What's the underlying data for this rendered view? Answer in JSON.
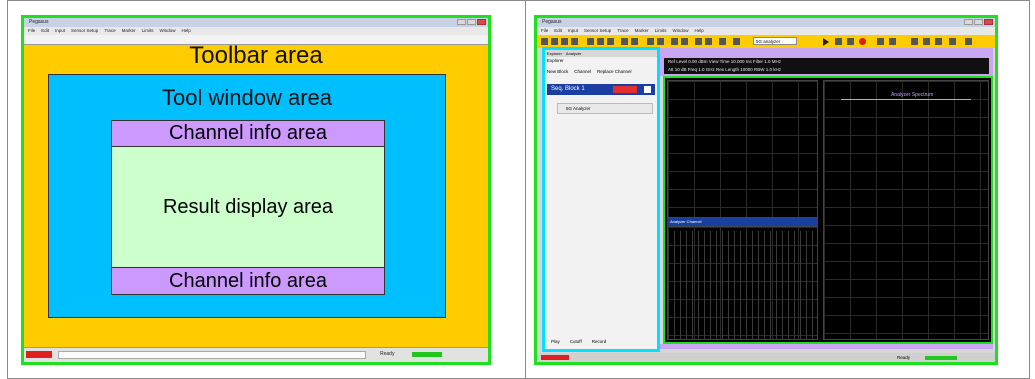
{
  "left_panel": {
    "window_title": "Pegasus",
    "menu": [
      "File",
      "Edit",
      "Input",
      "Sensor Setup",
      "Trace",
      "Marker",
      "Limits",
      "Window",
      "Help"
    ],
    "labels": {
      "toolbar_area": "Toolbar area",
      "tool_window_area": "Tool window area",
      "channel_info_top": "Channel info area",
      "result_display": "Result display area",
      "channel_info_bottom": "Channel info area"
    },
    "status_text": "Ready"
  },
  "right_panel": {
    "window_title": "Pegasus",
    "menu": [
      "File",
      "Edit",
      "Input",
      "Sensor Setup",
      "Trace",
      "Marker",
      "Limits",
      "Window",
      "Help"
    ],
    "toolbar_combo": "5G analyzer",
    "tool_window": {
      "tabs": [
        "Explorer",
        "Analyzer"
      ],
      "title": "Explorer",
      "buttons": [
        "New Block",
        "Channel",
        "Replace Channel"
      ],
      "sequence_block": "Seq. Block 1",
      "analyzer_item": "5G Analyzer",
      "footer_buttons": [
        "Play",
        "Cutoff",
        "Record"
      ]
    },
    "channel_info": {
      "row1": "Ref Level  0.00 dBm     View Time  10.000 ms     Filter  1.0 MHz",
      "row2": "Att  10 dB     Freq  1.0 GHz     Res Length  10000     RBW  1.0 kHz"
    },
    "result": {
      "lower_left_header": "Analyzer  Channel",
      "right_title": "Analyzer Spectrum"
    },
    "status_text": "Ready"
  },
  "colors": {
    "frame_green": "#1ee01e",
    "toolbar_yellow": "#ffcc00",
    "tool_window_blue": "#00bfff",
    "channel_info_purple": "#cc99ff",
    "result_green": "#ccffcc"
  }
}
